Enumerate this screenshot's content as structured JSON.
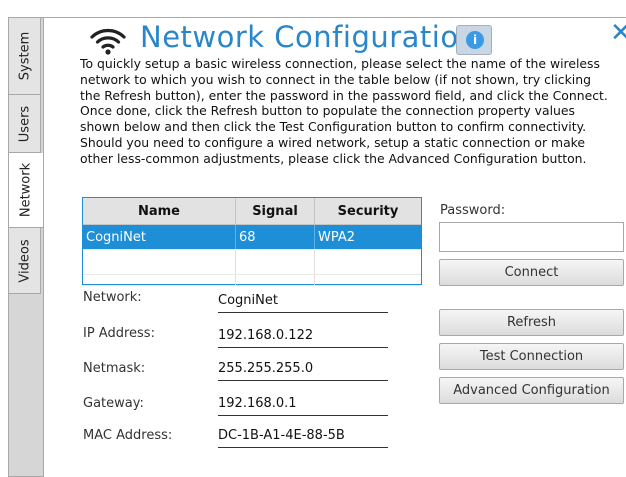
{
  "tabs": [
    {
      "label": "System",
      "active": false
    },
    {
      "label": "Users",
      "active": false
    },
    {
      "label": "Network",
      "active": true
    },
    {
      "label": "Videos",
      "active": false
    }
  ],
  "header": {
    "title": "Network Configuration",
    "icon": "wifi-icon",
    "info_icon": "info-icon",
    "close_icon": "close-icon"
  },
  "description": "To quickly setup a basic wireless connection, please select the name of the wireless network to which you wish to connect in the table below (if not shown, try clicking the Refresh button), enter the password in the password field, and click the Connect. Once done, click the Refresh button to populate the connection property values shown below and then click the Test Configuration button to confirm connectivity. Should you need to configure a wired network, setup a static connection or make other less-common adjustments, please click the Advanced Configuration button.",
  "network_table": {
    "columns": [
      "Name",
      "Signal",
      "Security"
    ],
    "rows": [
      {
        "name": "CogniNet",
        "signal": "68",
        "security": "WPA2",
        "selected": true
      },
      {
        "name": "",
        "signal": "",
        "security": "",
        "selected": false
      },
      {
        "name": "",
        "signal": "",
        "security": "",
        "selected": false
      }
    ]
  },
  "fields": {
    "network": {
      "label": "Network:",
      "value": "CogniNet"
    },
    "ip": {
      "label": "IP Address:",
      "value": "192.168.0.122"
    },
    "netmask": {
      "label": "Netmask:",
      "value": "255.255.255.0"
    },
    "gateway": {
      "label": "Gateway:",
      "value": "192.168.0.1"
    },
    "mac": {
      "label": "MAC Address:",
      "value": "DC-1B-A1-4E-88-5B"
    }
  },
  "password": {
    "label": "Password:",
    "value": "",
    "placeholder": ""
  },
  "buttons": {
    "connect": "Connect",
    "refresh": "Refresh",
    "test": "Test Connection",
    "advanced": "Advanced Configuration"
  },
  "colors": {
    "accent": "#2a86c8",
    "selection": "#1e8ed6"
  }
}
